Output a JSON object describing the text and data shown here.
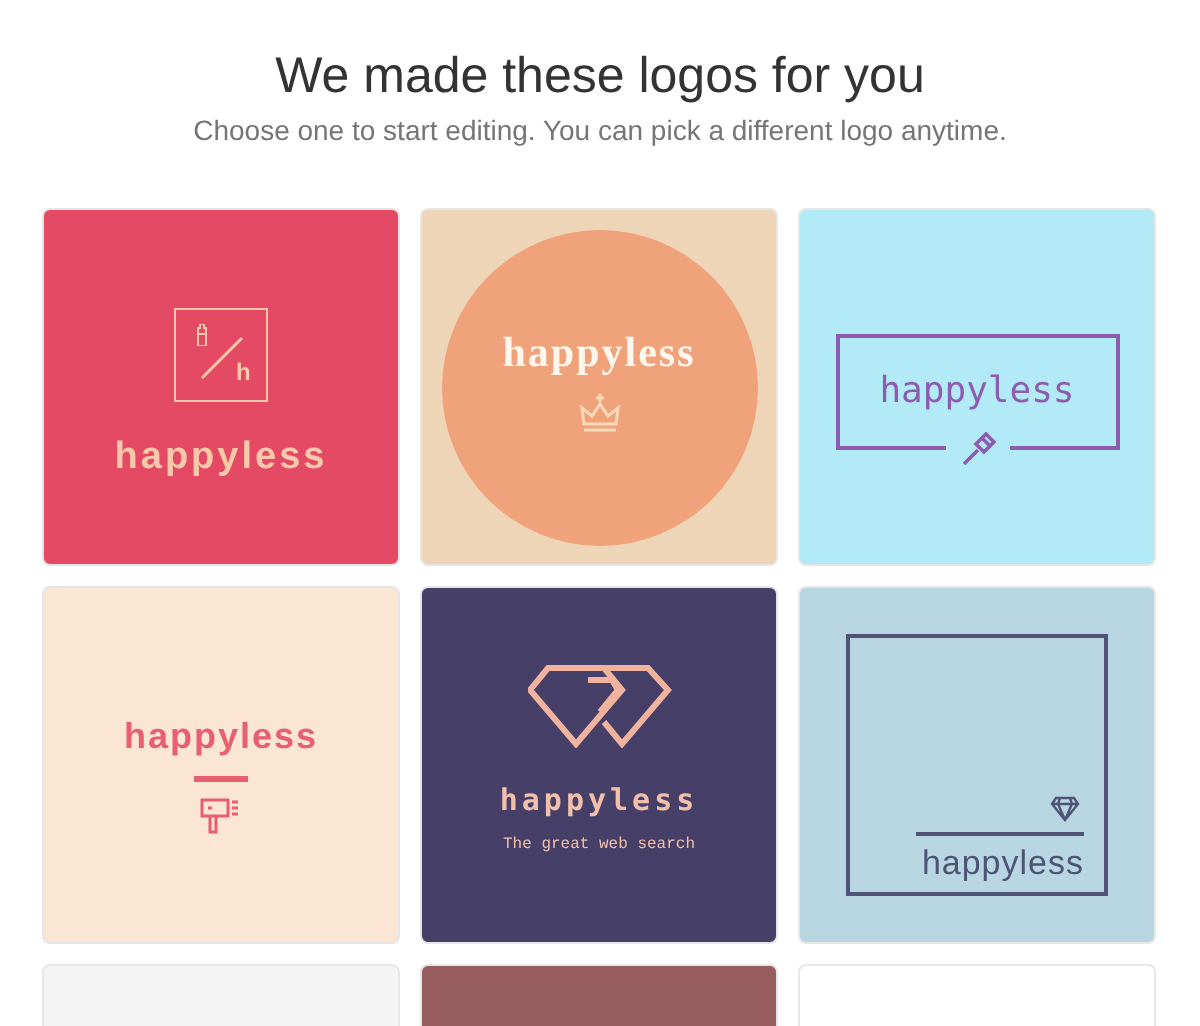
{
  "header": {
    "title": "We made these logos for you",
    "subtitle": "Choose one to start editing. You can pick a different logo anytime."
  },
  "logos": [
    {
      "kind": "boxed-monogram",
      "color": "#e44a63",
      "name": "happyless",
      "monogram": "h"
    },
    {
      "kind": "circle-crown",
      "color": "#efd5b8",
      "name": "happyless"
    },
    {
      "kind": "frame-brush",
      "color": "#b3eaf8",
      "name": "happyless"
    },
    {
      "kind": "dryer",
      "color": "#fae6d3",
      "name": "happyless"
    },
    {
      "kind": "diamond",
      "color": "#463f67",
      "name": "happyless",
      "tagline": "The great web search"
    },
    {
      "kind": "square-gem",
      "color": "#b8d6e1",
      "name": "happyless"
    },
    {
      "kind": "blank",
      "color": "#f4f4f4"
    },
    {
      "kind": "blank",
      "color": "#965c5e"
    },
    {
      "kind": "blank",
      "color": "#ffffff"
    }
  ]
}
